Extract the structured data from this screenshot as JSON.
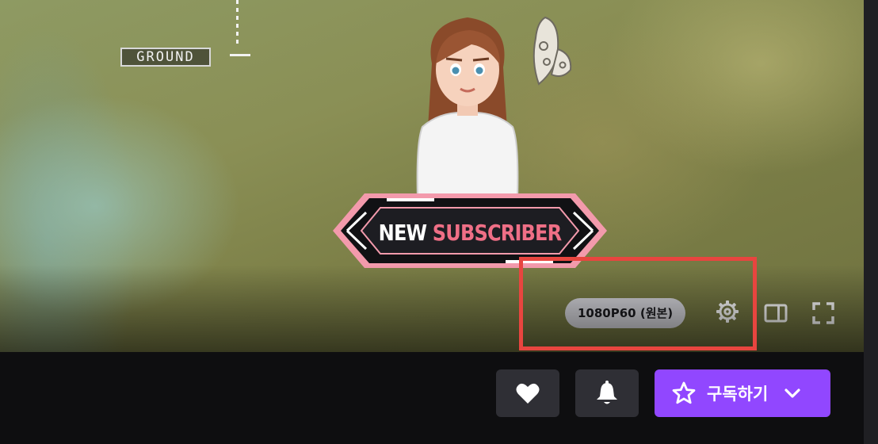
{
  "overlay": {
    "hud_label": "GROUND",
    "banner_word1": "NEW",
    "banner_word2": "SUBSCRIBER"
  },
  "player": {
    "quality_label": "1080P60 (원본)",
    "icons": [
      "settings-gear-icon",
      "theatre-mode-icon",
      "fullscreen-icon"
    ]
  },
  "actions": {
    "follow_icon": "heart-icon",
    "notify_icon": "bell-icon",
    "subscribe_label": "구독하기",
    "subscribe_icons": [
      "star-outline-icon",
      "chevron-down-icon"
    ]
  },
  "colors": {
    "accent_purple": "#9147ff",
    "highlight_red": "#e8453f",
    "button_gray": "#2f2f35",
    "banner_pink": "#ef6f86"
  }
}
